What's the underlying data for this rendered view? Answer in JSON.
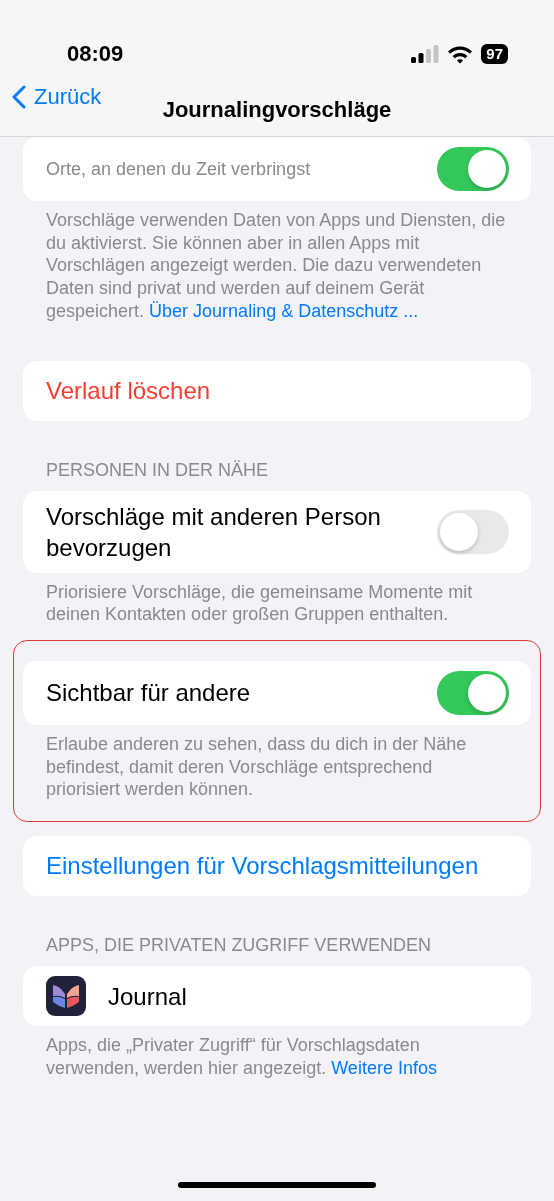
{
  "status_bar": {
    "time": "08:09",
    "battery": "97"
  },
  "nav": {
    "back": "Zurück",
    "title": "Journalingvorschläge"
  },
  "sections": [
    {
      "highlighted": false,
      "rows": [
        {
          "kind": "toggle",
          "subtitle": "Orte, an denen du Zeit verbringst",
          "on": true
        }
      ],
      "footer": "Vorschläge verwenden Daten von Apps und Diensten, die du aktivierst. Sie können aber in allen Apps mit Vorschlägen angezeigt werden. Die dazu verwendeten Daten sind privat und werden auf deinem Gerät gespeichert.",
      "footer_link": "Über Journaling & Datenschutz ..."
    },
    {
      "highlighted": false,
      "rows": [
        {
          "kind": "destructive",
          "title": "Verlauf löschen"
        }
      ]
    },
    {
      "highlighted": false,
      "header": "PERSONEN IN DER NÄHE",
      "rows": [
        {
          "kind": "toggle",
          "title": "Vorschläge mit anderen Person bevorzugen",
          "on": false
        }
      ],
      "footer": "Priorisiere Vorschläge, die gemeinsame Momente mit deinen Kontakten oder großen Gruppen enthalten."
    },
    {
      "highlighted": true,
      "rows": [
        {
          "kind": "toggle",
          "title": "Sichtbar für andere",
          "on": true
        }
      ],
      "footer": "Erlaube anderen zu sehen, dass du dich in der Nähe befindest, damit deren Vorschläge entsprechend priorisiert werden können."
    },
    {
      "highlighted": false,
      "rows": [
        {
          "kind": "link",
          "title": "Einstellungen für Vorschlagsmitteilungen"
        }
      ]
    },
    {
      "highlighted": false,
      "header": "APPS, DIE PRIVATEN ZUGRIFF VERWENDEN",
      "rows": [
        {
          "kind": "app",
          "title": "Journal"
        }
      ],
      "footer": "Apps, die „Privater Zugriff“ für Vorschlagsdaten verwenden, werden hier angezeigt.",
      "footer_link": "Weitere Infos"
    }
  ]
}
